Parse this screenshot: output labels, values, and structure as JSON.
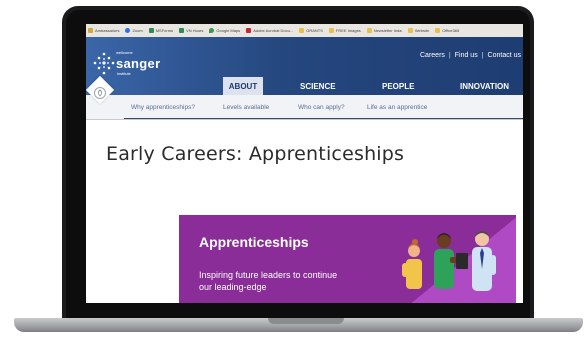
{
  "bookmarks": [
    {
      "label": "Ambassadors",
      "color": "#d3a83a"
    },
    {
      "label": "Zoom",
      "color": "#2d6ff0"
    },
    {
      "label": "MSForms",
      "color": "#2f8b58"
    },
    {
      "label": "VN Hours",
      "color": "#2f8b58"
    },
    {
      "label": "Google Maps",
      "color": "#3b9a4d"
    },
    {
      "label": "Adobe Acrobat Docu...",
      "color": "#c8262d"
    },
    {
      "label": "GRANTS",
      "color": "#e7c04b"
    },
    {
      "label": "FREE Images",
      "color": "#e7c04b"
    },
    {
      "label": "Newsletter links",
      "color": "#e7c04b"
    },
    {
      "label": "Website",
      "color": "#e7c04b"
    },
    {
      "label": "Office365",
      "color": "#e7c04b"
    }
  ],
  "header": {
    "logo_small": "wellcome",
    "logo_big": "sanger",
    "logo_inst": "institute",
    "util_links": [
      "Careers",
      "Find us",
      "Contact us"
    ],
    "nav": [
      "ABOUT",
      "SCIENCE",
      "PEOPLE",
      "INNOVATION"
    ]
  },
  "subnav": [
    "Why apprenticeships?",
    "Levels available",
    "Who can apply?",
    "Life as an apprentice"
  ],
  "page": {
    "title": "Early Careers: Apprenticeships"
  },
  "hero": {
    "title": "Apprenticeships",
    "subtitle": "Inspiring future leaders to continue our leading-edge"
  },
  "colors": {
    "header_blue": "#25477f",
    "hero_purple": "#8a2d98",
    "hero_accent": "#b04ac4"
  }
}
